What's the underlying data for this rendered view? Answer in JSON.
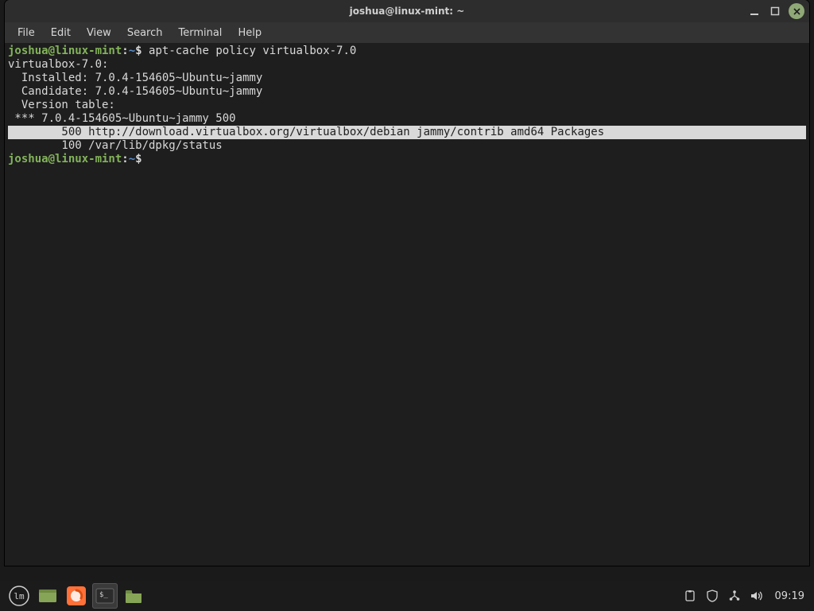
{
  "window": {
    "title": "joshua@linux-mint: ~",
    "menu": [
      "File",
      "Edit",
      "View",
      "Search",
      "Terminal",
      "Help"
    ]
  },
  "prompt": {
    "user_host": "joshua@linux-mint",
    "sep": ":",
    "path": "~",
    "dollar": "$"
  },
  "terminal": {
    "cmd1": "apt-cache policy virtualbox-7.0",
    "out1": "virtualbox-7.0:",
    "out2": "  Installed: 7.0.4-154605~Ubuntu~jammy",
    "out3": "  Candidate: 7.0.4-154605~Ubuntu~jammy",
    "out4": "  Version table:",
    "out5": " *** 7.0.4-154605~Ubuntu~jammy 500",
    "out6": "        500 http://download.virtualbox.org/virtualbox/debian jammy/contrib amd64 Packages",
    "out7": "        100 /var/lib/dpkg/status"
  },
  "taskbar": {
    "clock": "09:19"
  }
}
